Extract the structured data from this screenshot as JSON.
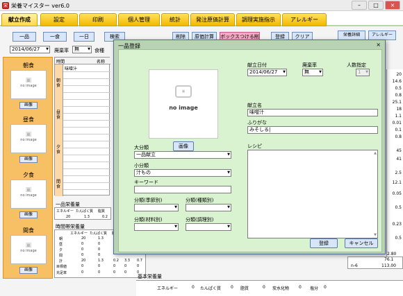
{
  "window": {
    "title": "栄養マイスター ver6.0",
    "icon": "app-icon"
  },
  "tabs": [
    {
      "label": "献立作成"
    },
    {
      "label": "設定"
    },
    {
      "label": "印刷"
    },
    {
      "label": "個人管理"
    },
    {
      "label": "統計"
    },
    {
      "label": "発注原価計算"
    },
    {
      "label": "調理実施指示"
    },
    {
      "label": "アレルギー"
    }
  ],
  "toolbar": {
    "one_item": "一品",
    "one_meal": "一食",
    "one_day": "一日",
    "search": "検索",
    "delete": "削除",
    "recalc": "原価計算",
    "pink": "ボックスつける削除",
    "register": "登録",
    "clear": "クリア",
    "nutrition_detail": "栄養詳細",
    "allergy": "アレルギー",
    "date": "2014/06/27",
    "waste_label": "廃棄率",
    "waste_value": "無",
    "meal_label": "食種"
  },
  "left_panel": {
    "meals": [
      {
        "label": "朝食",
        "img": "no image",
        "btn": "画像"
      },
      {
        "label": "昼食",
        "img": "no image",
        "btn": "画像"
      },
      {
        "label": "夕食",
        "img": "no image",
        "btn": "画像"
      },
      {
        "label": "間食",
        "img": "no image",
        "btn": "画像"
      }
    ]
  },
  "bg_table": {
    "header_time": "時間",
    "header_name": "名称",
    "first_row": "味噌汁",
    "sides": [
      "朝食",
      "昼食",
      "夕食",
      "間食"
    ]
  },
  "one_item_nutrition": {
    "title": "一品栄養量",
    "headers": [
      "エネルギー",
      "たんぱく質",
      "脂質"
    ],
    "values": [
      "20",
      "1.3",
      "0.2"
    ]
  },
  "hourly_nutrition": {
    "title": "時間帯栄養量",
    "headers": [
      "エネルギー",
      "たんぱく質",
      "脂質"
    ],
    "rows": [
      {
        "label": "朝",
        "v": [
          "20",
          "1.3",
          ""
        ]
      },
      {
        "label": "昼",
        "v": [
          "0",
          "0",
          ""
        ]
      },
      {
        "label": "夕",
        "v": [
          "0",
          "0",
          ""
        ]
      },
      {
        "label": "間",
        "v": [
          "0",
          "0",
          ""
        ]
      },
      {
        "label": "計",
        "v": [
          "20",
          "1.3",
          "0.2",
          "3.3",
          "0.7"
        ]
      },
      {
        "label": "目標値",
        "v": [
          "0",
          "0",
          "0",
          "0",
          "0"
        ]
      },
      {
        "label": "充足率",
        "v": [
          "0",
          "0",
          "0",
          "0",
          "0"
        ]
      }
    ]
  },
  "basic_nutrition": {
    "title": "基本栄養量",
    "items": [
      "エネルギー",
      "0",
      "たんぱく質",
      "0",
      "脂質",
      "0",
      "炭水化物",
      "0",
      "塩分",
      "0"
    ]
  },
  "right_col_values": [
    "20",
    "14.6",
    "0.5",
    "0.8",
    "25.1",
    "18",
    "1.1",
    "0.01",
    "0.1",
    "0.8",
    "45",
    "41",
    "2.5",
    "12.1",
    "0.05",
    "0.5",
    "0.23",
    "0.5"
  ],
  "right_strip": {
    "v1": "76.1",
    "label": "n-6",
    "v2": "2.80",
    "v3": "113.00"
  },
  "dialog": {
    "title": "一品登録",
    "close": "×",
    "photo_text": "no image",
    "photo_btn": "画像",
    "date_label": "献立日付",
    "date_value": "2014/06/27",
    "waste_label": "廃棄率",
    "waste_value": "無",
    "people_label": "人数指定",
    "people_value": "1",
    "name_label": "献立名",
    "name_value": "味噌汁",
    "kana_label": "ふりがな",
    "kana_value": "みそしる|",
    "recipe_label": "レシピ",
    "cat_large_label": "大分類",
    "cat_large_value": "一品献立",
    "cat_small_label": "小分類",
    "cat_small_value": "汁もの",
    "keyword_label": "キーワード",
    "keyword_value": "",
    "cat_season_label": "分類(季節別)",
    "cat_type_label": "分類(種類別)",
    "cat_material_label": "分類(材料別)",
    "cat_cooking_label": "分類(調理別)",
    "register_btn": "登録",
    "cancel_btn": "キャンセル"
  }
}
